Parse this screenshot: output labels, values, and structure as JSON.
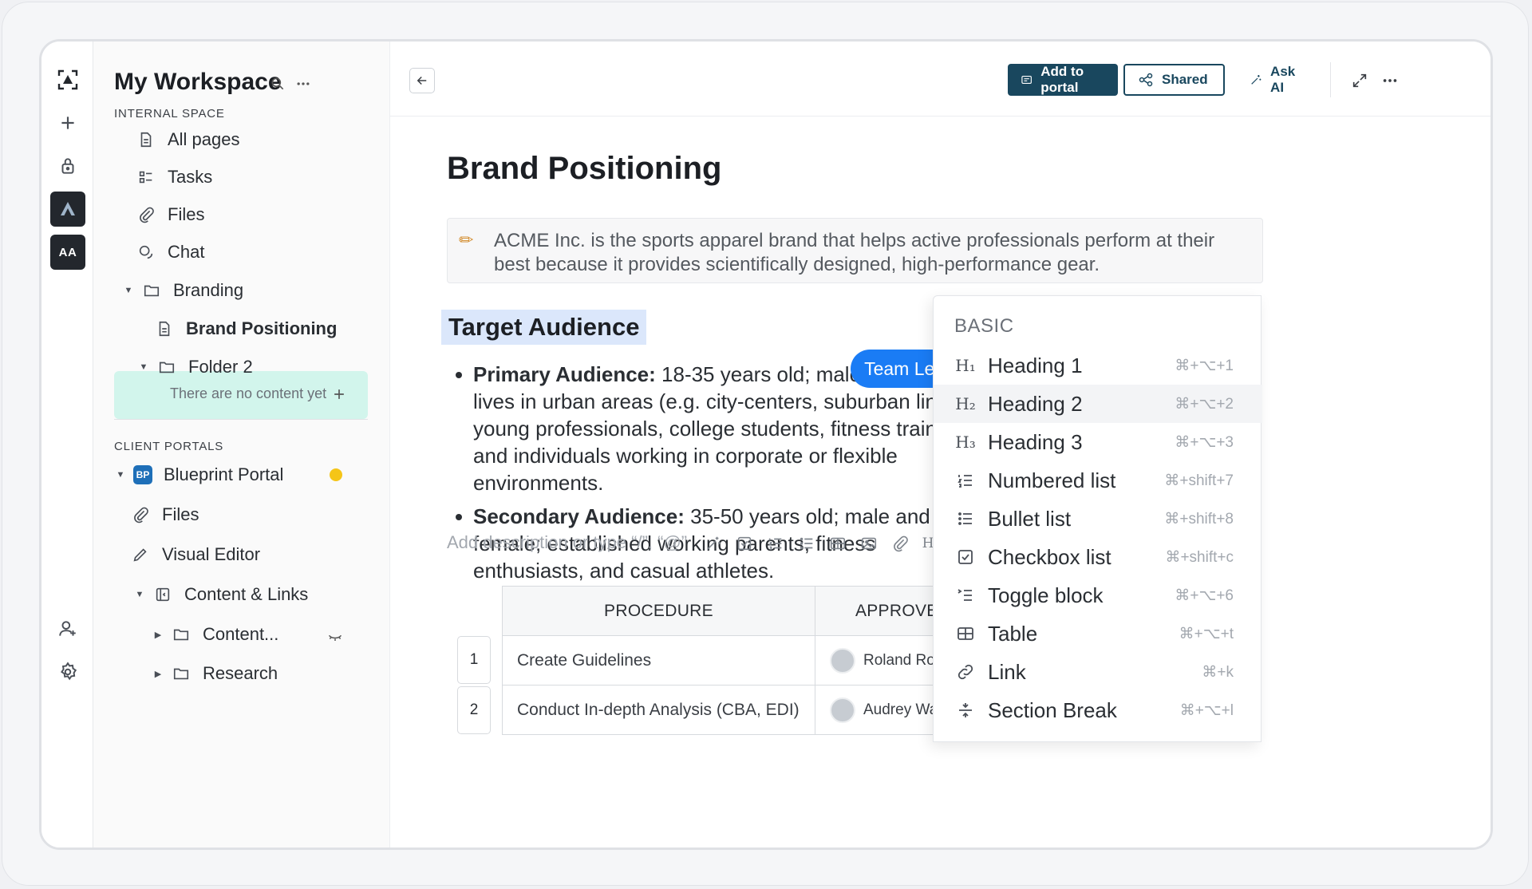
{
  "rail": {
    "avatar_initials": "AA"
  },
  "sidebar": {
    "title": "My Workspace",
    "internal_label": "INTERNAL SPACE",
    "items": {
      "all_pages": "All pages",
      "tasks": "Tasks",
      "files": "Files",
      "chat": "Chat",
      "branding": "Branding",
      "brand_positioning": "Brand Positioning",
      "folder2": "Folder 2",
      "empty_note": "There are no content yet"
    },
    "client_label": "CLIENT PORTALS",
    "portal": {
      "badge": "BP",
      "name": "Blueprint Portal",
      "files": "Files",
      "visual_editor": "Visual Editor",
      "content_links": "Content & Links",
      "content": "Content...",
      "research": "Research"
    }
  },
  "toolbar": {
    "add_to_portal": "Add to portal",
    "shared": "Shared",
    "ask_ai": "Ask AI"
  },
  "doc": {
    "title": "Brand Positioning",
    "callout": "ACME Inc. is the sports apparel brand that helps active professionals perform at their best because it provides scientifically designed, high-performance gear.",
    "heading": "Target Audience",
    "bullets": [
      {
        "label": "Primary Audience:",
        "text": " 18-35 years old; male and female; lives in urban areas (e.g. city-centers, suburban lines); young professionals, college students, fitness trainers, and individuals working in corporate or flexible environments."
      },
      {
        "label": "Secondary Audience:",
        "text": " 35-50 years old; male and female; established working parents, fitness enthusiasts, and casual athletes."
      }
    ],
    "tooltip": "Team Lead",
    "placeholder": "Add description or type “/”, “@”"
  },
  "table": {
    "headers": [
      "PROCEDURE",
      "APPROVED"
    ],
    "rows": [
      {
        "num": "1",
        "procedure": "Create Guidelines",
        "approved": "Roland Robinson"
      },
      {
        "num": "2",
        "procedure": "Conduct In-depth Analysis (CBA, EDI)",
        "approved": "Audrey Ward"
      }
    ]
  },
  "menu": {
    "section": "BASIC",
    "items": [
      {
        "icon": "h1-icon",
        "glyph": "H₁",
        "label": "Heading 1",
        "shortcut": "⌘+⌥+1"
      },
      {
        "icon": "h2-icon",
        "glyph": "H₂",
        "label": "Heading 2",
        "shortcut": "⌘+⌥+2"
      },
      {
        "icon": "h3-icon",
        "glyph": "H₃",
        "label": "Heading 3",
        "shortcut": "⌘+⌥+3"
      },
      {
        "icon": "numbered-list-icon",
        "glyph": "",
        "label": "Numbered list",
        "shortcut": "⌘+shift+7"
      },
      {
        "icon": "bullet-list-icon",
        "glyph": "",
        "label": "Bullet list",
        "shortcut": "⌘+shift+8"
      },
      {
        "icon": "checkbox-icon",
        "glyph": "",
        "label": "Checkbox list",
        "shortcut": "⌘+shift+c"
      },
      {
        "icon": "toggle-icon",
        "glyph": "",
        "label": "Toggle block",
        "shortcut": "⌘+⌥+6"
      },
      {
        "icon": "table-icon",
        "glyph": "",
        "label": "Table",
        "shortcut": "⌘+⌥+t"
      },
      {
        "icon": "link-icon",
        "glyph": "",
        "label": "Link",
        "shortcut": "⌘+k"
      },
      {
        "icon": "section-break-icon",
        "glyph": "",
        "label": "Section Break",
        "shortcut": "⌘+⌥+l"
      }
    ]
  },
  "colors": {
    "accent": "#19475e",
    "active_item": "#d2f5ec",
    "tooltip": "#1a7cf5",
    "heading_highlight": "#dbe7fb"
  }
}
